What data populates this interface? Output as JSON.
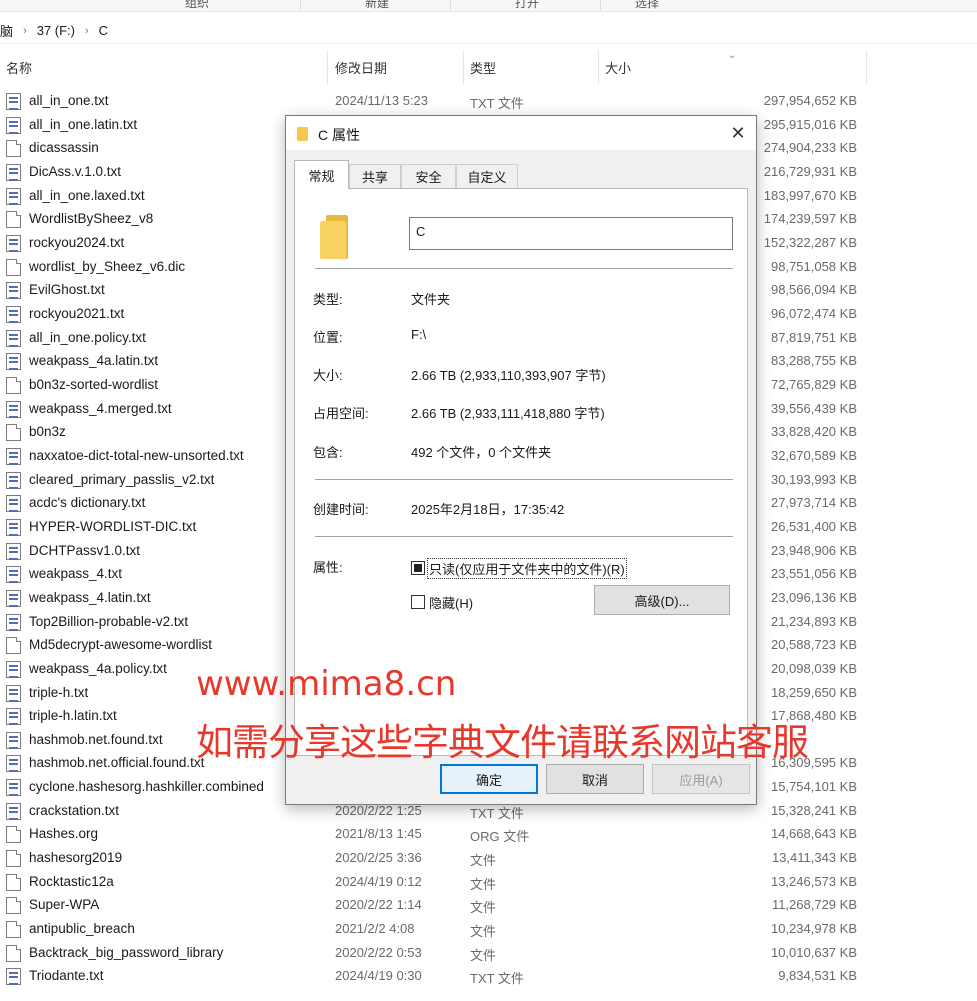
{
  "ribbon": {
    "items": [
      "组织",
      "新建",
      "打开",
      "选择"
    ]
  },
  "breadcrumb": {
    "items": [
      "脑",
      "37 (F:)",
      "C"
    ]
  },
  "columns": {
    "name": "名称",
    "date": "修改日期",
    "type": "类型",
    "size": "大小"
  },
  "files": [
    {
      "name": "all_in_one.txt",
      "date": "2024/11/13 5:23",
      "type": "TXT 文件",
      "size": "297,954,652 KB",
      "icon": "txt"
    },
    {
      "name": "all_in_one.latin.txt",
      "date": "",
      "type": "",
      "size": "295,915,016 KB",
      "icon": "txt"
    },
    {
      "name": "dicassassin",
      "date": "",
      "type": "",
      "size": "274,904,233 KB",
      "icon": "plain"
    },
    {
      "name": "DicAss.v.1.0.txt",
      "date": "",
      "type": "",
      "size": "216,729,931 KB",
      "icon": "txt"
    },
    {
      "name": "all_in_one.laxed.txt",
      "date": "",
      "type": "",
      "size": "183,997,670 KB",
      "icon": "txt"
    },
    {
      "name": "WordlistBySheez_v8",
      "date": "",
      "type": "",
      "size": "174,239,597 KB",
      "icon": "plain"
    },
    {
      "name": "rockyou2024.txt",
      "date": "",
      "type": "",
      "size": "152,322,287 KB",
      "icon": "txt"
    },
    {
      "name": "wordlist_by_Sheez_v6.dic",
      "date": "",
      "type": "",
      "size": "98,751,058 KB",
      "icon": "plain"
    },
    {
      "name": "EvilGhost.txt",
      "date": "",
      "type": "",
      "size": "98,566,094 KB",
      "icon": "txt"
    },
    {
      "name": "rockyou2021.txt",
      "date": "",
      "type": "",
      "size": "96,072,474 KB",
      "icon": "txt"
    },
    {
      "name": "all_in_one.policy.txt",
      "date": "",
      "type": "",
      "size": "87,819,751 KB",
      "icon": "txt"
    },
    {
      "name": "weakpass_4a.latin.txt",
      "date": "",
      "type": "",
      "size": "83,288,755 KB",
      "icon": "txt"
    },
    {
      "name": "b0n3z-sorted-wordlist",
      "date": "",
      "type": "",
      "size": "72,765,829 KB",
      "icon": "plain"
    },
    {
      "name": "weakpass_4.merged.txt",
      "date": "",
      "type": "",
      "size": "39,556,439 KB",
      "icon": "txt"
    },
    {
      "name": "b0n3z",
      "date": "",
      "type": "",
      "size": "33,828,420 KB",
      "icon": "plain"
    },
    {
      "name": "naxxatoe-dict-total-new-unsorted.txt",
      "date": "",
      "type": "",
      "size": "32,670,589 KB",
      "icon": "txt"
    },
    {
      "name": "cleared_primary_passlis_v2.txt",
      "date": "",
      "type": "",
      "size": "30,193,993 KB",
      "icon": "txt"
    },
    {
      "name": "acdc's dictionary.txt",
      "date": "",
      "type": "",
      "size": "27,973,714 KB",
      "icon": "txt"
    },
    {
      "name": "HYPER-WORDLIST-DIC.txt",
      "date": "",
      "type": "",
      "size": "26,531,400 KB",
      "icon": "txt"
    },
    {
      "name": "DCHTPassv1.0.txt",
      "date": "",
      "type": "",
      "size": "23,948,906 KB",
      "icon": "txt"
    },
    {
      "name": "weakpass_4.txt",
      "date": "",
      "type": "",
      "size": "23,551,056 KB",
      "icon": "txt"
    },
    {
      "name": "weakpass_4.latin.txt",
      "date": "",
      "type": "",
      "size": "23,096,136 KB",
      "icon": "txt"
    },
    {
      "name": "Top2Billion-probable-v2.txt",
      "date": "",
      "type": "",
      "size": "21,234,893 KB",
      "icon": "txt"
    },
    {
      "name": "Md5decrypt-awesome-wordlist",
      "date": "",
      "type": "",
      "size": "20,588,723 KB",
      "icon": "plain"
    },
    {
      "name": "weakpass_4a.policy.txt",
      "date": "",
      "type": "",
      "size": "20,098,039 KB",
      "icon": "txt"
    },
    {
      "name": "triple-h.txt",
      "date": "",
      "type": "",
      "size": "18,259,650 KB",
      "icon": "txt"
    },
    {
      "name": "triple-h.latin.txt",
      "date": "",
      "type": "",
      "size": "17,868,480 KB",
      "icon": "txt"
    },
    {
      "name": "hashmob.net.found.txt",
      "date": "",
      "type": "",
      "size": "",
      "icon": "txt"
    },
    {
      "name": "hashmob.net.official.found.txt",
      "date": "",
      "type": "",
      "size": "16,309,595 KB",
      "icon": "txt"
    },
    {
      "name": "cyclone.hashesorg.hashkiller.combined",
      "date": "",
      "type": "",
      "size": "15,754,101 KB",
      "icon": "txt"
    },
    {
      "name": "crackstation.txt",
      "date": "2020/2/22 1:25",
      "type": "TXT 文件",
      "size": "15,328,241 KB",
      "icon": "txt"
    },
    {
      "name": "Hashes.org",
      "date": "2021/8/13 1:45",
      "type": "ORG 文件",
      "size": "14,668,643 KB",
      "icon": "plain"
    },
    {
      "name": "hashesorg2019",
      "date": "2020/2/25 3:36",
      "type": "文件",
      "size": "13,411,343 KB",
      "icon": "plain"
    },
    {
      "name": "Rocktastic12a",
      "date": "2024/4/19 0:12",
      "type": "文件",
      "size": "13,246,573 KB",
      "icon": "plain"
    },
    {
      "name": "Super-WPA",
      "date": "2020/2/22 1:14",
      "type": "文件",
      "size": "11,268,729 KB",
      "icon": "plain"
    },
    {
      "name": "antipublic_breach",
      "date": "2021/2/2 4:08",
      "type": "文件",
      "size": "10,234,978 KB",
      "icon": "plain"
    },
    {
      "name": "Backtrack_big_password_library",
      "date": "2020/2/22 0:53",
      "type": "文件",
      "size": "10,010,637 KB",
      "icon": "plain"
    },
    {
      "name": "Triodante.txt",
      "date": "2024/4/19 0:30",
      "type": "TXT 文件",
      "size": "9,834,531 KB",
      "icon": "txt"
    }
  ],
  "dialog": {
    "title": "C 属性",
    "close_glyph": "✕",
    "tabs": [
      "常规",
      "共享",
      "安全",
      "自定义"
    ],
    "name_value": "C",
    "props": [
      {
        "label": "类型:",
        "value": "文件夹"
      },
      {
        "label": "位置:",
        "value": "F:\\"
      },
      {
        "label": "大小:",
        "value": "2.66 TB (2,933,110,393,907 字节)"
      },
      {
        "label": "占用空间:",
        "value": "2.66 TB (2,933,111,418,880 字节)"
      },
      {
        "label": "包含:",
        "value": "492 个文件，0 个文件夹"
      }
    ],
    "created_label": "创建时间:",
    "created_value": "2025年2月18日，17:35:42",
    "attr_label": "属性:",
    "readonly_label": "只读(仅应用于文件夹中的文件)(R)",
    "hidden_label": "隐藏(H)",
    "advanced_label": "高级(D)...",
    "ok_label": "确定",
    "cancel_label": "取消",
    "apply_label": "应用(A)"
  },
  "watermark": {
    "line1": "www.mima8.cn",
    "line2": "如需分享这些字典文件请联系网站客服"
  }
}
